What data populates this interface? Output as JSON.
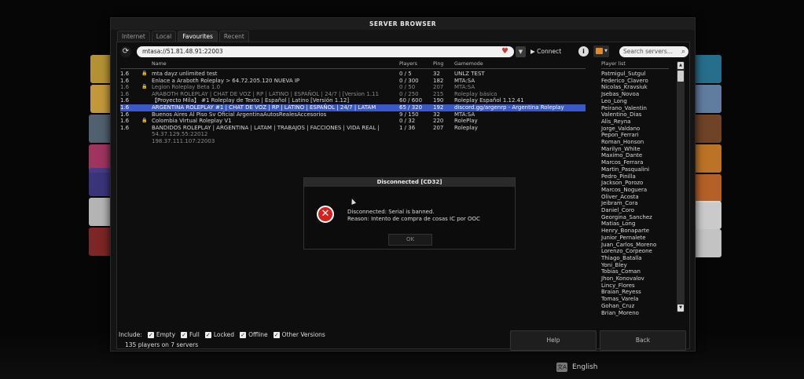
{
  "window": {
    "title": "SERVER BROWSER"
  },
  "tabs": [
    {
      "label": "Internet",
      "active": false
    },
    {
      "label": "Local",
      "active": false
    },
    {
      "label": "Favourites",
      "active": true
    },
    {
      "label": "Recent",
      "active": false
    }
  ],
  "toolbar": {
    "refresh_icon": "refresh-icon",
    "address_value": "mtasa://51.81.48.91:22003",
    "favourite_icon": "heart-icon",
    "connect_label": "Connect",
    "search_placeholder": "Search servers..."
  },
  "columns": {
    "name": "Name",
    "players": "Players",
    "ping": "Ping",
    "gamemode": "Gamemode"
  },
  "servers": [
    {
      "version": "1.6",
      "locked": true,
      "name": "mta dayz unlimited test",
      "players": "0 / 5",
      "ping": "32",
      "gamemode": "UNLZ TEST",
      "state": "normal"
    },
    {
      "version": "1.6",
      "locked": false,
      "name": "Enlace a Araboth Roleplay > 64.72.205.120 NUEVA IP",
      "players": "0 / 300",
      "ping": "182",
      "gamemode": "MTA:SA",
      "state": "normal"
    },
    {
      "version": "1.6",
      "locked": true,
      "name": "Legion Roleplay Beta 1.0",
      "players": "0 / 50",
      "ping": "207",
      "gamemode": "MTA:SA",
      "state": "dim"
    },
    {
      "version": "1.6",
      "locked": false,
      "name": "ARABOTH ROLEPLAY | CHAT DE VOZ | RP | LATINO | ESPAÑOL | 24/7 | [Version 1.11",
      "players": "0 / 250",
      "ping": "215",
      "gamemode": "Roleplay básico",
      "state": "dim"
    },
    {
      "version": "1.6",
      "locked": false,
      "name": "【Proyecto Mila】 #1 Roleplay de Texto  | Español | Latino [Versión 1.12]",
      "players": "60 / 600",
      "ping": "190",
      "gamemode": "Roleplay Español 1.12.41",
      "state": "normal"
    },
    {
      "version": "1.6",
      "locked": false,
      "name": "ARGENTINA ROLEPLAY #1 | CHAT DE VOZ | RP | LATINO | ESPAÑOL | 24/7 | LATAM",
      "players": "65 / 320",
      "ping": "192",
      "gamemode": "discord.gg/argenrp - Argentina Roleplay",
      "state": "selected"
    },
    {
      "version": "1.6",
      "locked": false,
      "name": "Buenos Aires Al Piso Sv Oficial ArgentinaAutosRealesAccesorios",
      "players": "9 / 150",
      "ping": "32",
      "gamemode": "MTA:SA",
      "state": "normal"
    },
    {
      "version": "1.6",
      "locked": true,
      "name": "Colombia Virtual Roleplay V1",
      "players": "0 / 32",
      "ping": "220",
      "gamemode": "RolePlay",
      "state": "normal"
    },
    {
      "version": "1.6",
      "locked": false,
      "name": "BANDIDOS ROLEPLAY | ARGENTINA | LATAM | TRABAJOS | FACCIONES | VIDA REAL |",
      "players": "1 / 36",
      "ping": "207",
      "gamemode": "Roleplay",
      "state": "normal"
    },
    {
      "version": "",
      "locked": false,
      "name": "54.37.129.55:22012",
      "players": "",
      "ping": "",
      "gamemode": "",
      "state": "dim"
    },
    {
      "version": "",
      "locked": false,
      "name": "198.37.111.107:22003",
      "players": "",
      "ping": "",
      "gamemode": "",
      "state": "dim"
    }
  ],
  "player_list": {
    "header": "Player list",
    "players": [
      "Patmigul_Sutgul",
      "Federico_Clavero",
      "Nicolas_Kravsiuk",
      "Jsebas_Novoa",
      "Leo_Long",
      "Peirano_Valentin",
      "Valentino_Dias",
      "Alis_Reyna",
      "Jorge_Valdano",
      "Pepon_Ferrari",
      "Roman_Honson",
      "Marilyn_White",
      "Maximo_Dante",
      "Marcos_Ferrara",
      "Martin_Pasqualini",
      "Pedro_Pinilla",
      "Jackson_Porozo",
      "Marcos_Noguera",
      "Oliver_Acosta",
      "Jeibram_Cora",
      "Daniel_Coro",
      "Georgina_Sanchez",
      "Matias_Long",
      "Henry_Bonaparte",
      "Junior_Pernalete",
      "Juan_Carlos_Moreno",
      "Lorenzo_Corpeone",
      "Thiago_Batalla",
      "Yoni_Bley",
      "Tobias_Coman",
      "Jhon_Konovalov",
      "Lincy_Flores",
      "Braian_Reyess",
      "Tomas_Varela",
      "Gohan_Cruz",
      "Brian_Moreno"
    ]
  },
  "filters": {
    "label": "Include:",
    "options": [
      {
        "label": "Empty",
        "checked": true
      },
      {
        "label": "Full",
        "checked": true
      },
      {
        "label": "Locked",
        "checked": true
      },
      {
        "label": "Offline",
        "checked": true
      },
      {
        "label": "Other Versions",
        "checked": true
      }
    ]
  },
  "status": {
    "summary": "135 players on 7 servers"
  },
  "buttons": {
    "help": "Help",
    "back": "Back"
  },
  "dialog": {
    "title": "Disconnected [CD32]",
    "line1": "Disconnected: Serial is banned.",
    "line2": "Reason: Intento de compra de cosas IC por OOC",
    "ok_label": "OK"
  },
  "footer": {
    "language": "English"
  },
  "colors": {
    "selection": "#3b58c9",
    "error": "#d62020",
    "filter_accent": "#e08a2a"
  }
}
